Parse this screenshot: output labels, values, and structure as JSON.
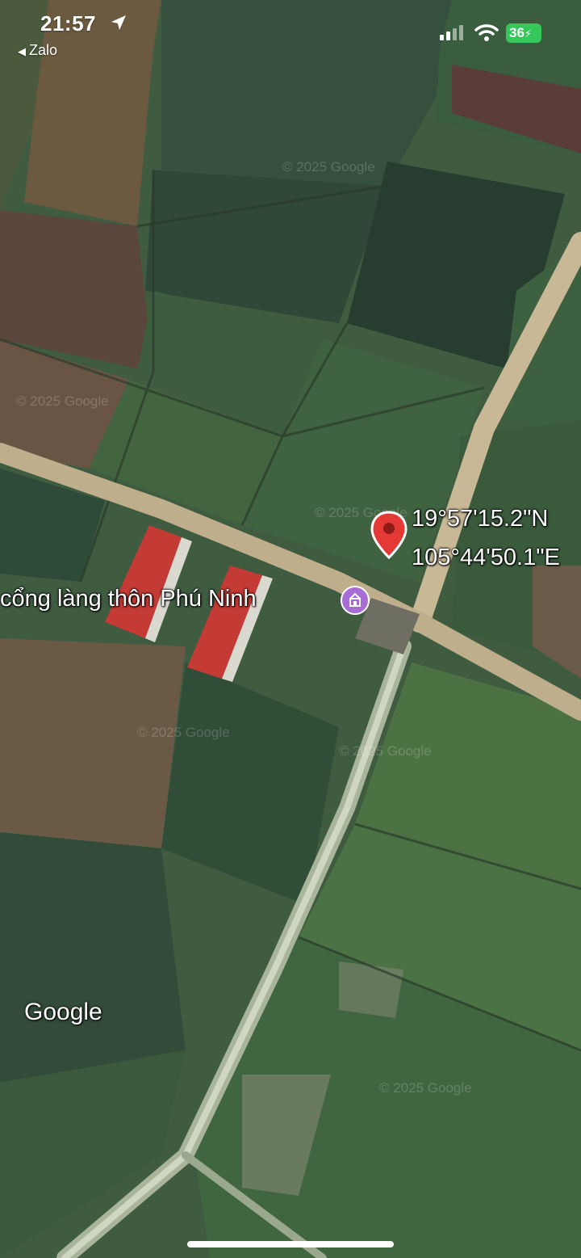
{
  "status_bar": {
    "time": "21:57",
    "back_app": "Zalo",
    "battery": "36"
  },
  "map": {
    "pin_latitude": "19°57'15.2\"N",
    "pin_longitude": "105°44'50.1\"E",
    "place_label": "cổng làng thôn Phú Ninh",
    "place_icon": "gate-icon",
    "watermark": "© 2025 Google",
    "logo": "Google",
    "pin_color": "#e53935",
    "poi_color": "#a86cd7"
  }
}
